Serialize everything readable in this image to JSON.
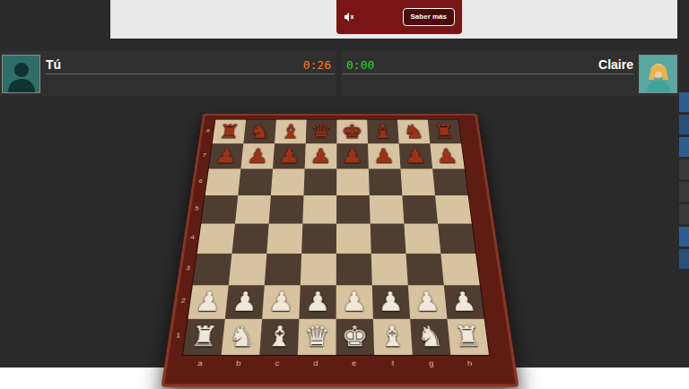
{
  "ad": {
    "button": "Saber más"
  },
  "players": [
    {
      "name": "Tú",
      "clock": "0:26",
      "color": "#ff7a1a",
      "side": "left"
    },
    {
      "name": "Claire",
      "clock": "0:00",
      "color": "#2fd12f",
      "side": "right"
    }
  ],
  "board": {
    "ranks": [
      "8",
      "7",
      "6",
      "5",
      "4",
      "3",
      "2",
      "1"
    ],
    "files": [
      "a",
      "b",
      "c",
      "d",
      "e",
      "f",
      "g",
      "h"
    ],
    "pieces": [
      {
        "square": "a8",
        "glyph": "♜",
        "color": "#9a3318"
      },
      {
        "square": "b8",
        "glyph": "♞",
        "color": "#9a3318"
      },
      {
        "square": "c8",
        "glyph": "♝",
        "color": "#9a3318"
      },
      {
        "square": "d8",
        "glyph": "♛",
        "color": "#9a3318"
      },
      {
        "square": "e8",
        "glyph": "♚",
        "color": "#9a3318"
      },
      {
        "square": "f8",
        "glyph": "♝",
        "color": "#9a3318"
      },
      {
        "square": "g8",
        "glyph": "♞",
        "color": "#9a3318"
      },
      {
        "square": "h8",
        "glyph": "♜",
        "color": "#9a3318"
      },
      {
        "square": "a7",
        "glyph": "♟",
        "color": "#9a3318"
      },
      {
        "square": "b7",
        "glyph": "♟",
        "color": "#9a3318"
      },
      {
        "square": "c7",
        "glyph": "♟",
        "color": "#9a3318"
      },
      {
        "square": "d7",
        "glyph": "♟",
        "color": "#9a3318"
      },
      {
        "square": "e7",
        "glyph": "♟",
        "color": "#9a3318"
      },
      {
        "square": "f7",
        "glyph": "♟",
        "color": "#9a3318"
      },
      {
        "square": "g7",
        "glyph": "♟",
        "color": "#9a3318"
      },
      {
        "square": "h7",
        "glyph": "♟",
        "color": "#9a3318"
      },
      {
        "square": "a2",
        "glyph": "♟",
        "color": "#f1e7d6"
      },
      {
        "square": "b2",
        "glyph": "♟",
        "color": "#f1e7d6"
      },
      {
        "square": "c2",
        "glyph": "♟",
        "color": "#f1e7d6"
      },
      {
        "square": "d2",
        "glyph": "♟",
        "color": "#f1e7d6"
      },
      {
        "square": "e2",
        "glyph": "♟",
        "color": "#f1e7d6"
      },
      {
        "square": "f2",
        "glyph": "♟",
        "color": "#f1e7d6"
      },
      {
        "square": "g2",
        "glyph": "♟",
        "color": "#f1e7d6"
      },
      {
        "square": "h2",
        "glyph": "♟",
        "color": "#f1e7d6"
      },
      {
        "square": "a1",
        "glyph": "♜",
        "color": "#f1e7d6"
      },
      {
        "square": "b1",
        "glyph": "♞",
        "color": "#f1e7d6"
      },
      {
        "square": "c1",
        "glyph": "♝",
        "color": "#f1e7d6"
      },
      {
        "square": "d1",
        "glyph": "♛",
        "color": "#f1e7d6"
      },
      {
        "square": "e1",
        "glyph": "♚",
        "color": "#f1e7d6"
      },
      {
        "square": "f1",
        "glyph": "♝",
        "color": "#f1e7d6"
      },
      {
        "square": "g1",
        "glyph": "♞",
        "color": "#f1e7d6"
      },
      {
        "square": "h1",
        "glyph": "♜",
        "color": "#f1e7d6"
      }
    ]
  }
}
